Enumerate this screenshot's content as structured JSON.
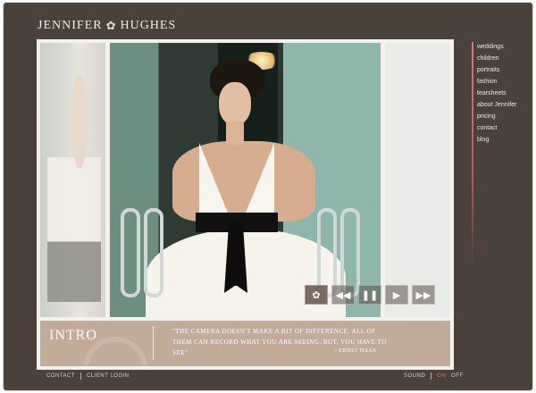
{
  "header": {
    "logo_left": "JENNIFER",
    "logo_right": "HUGHES",
    "logo_icon": "flower-icon"
  },
  "controls": {
    "buttons": [
      {
        "name": "flower-icon",
        "glyph": "✿"
      },
      {
        "name": "rewind-icon",
        "glyph": "◀◀"
      },
      {
        "name": "pause-icon",
        "glyph": "❚❚"
      },
      {
        "name": "play-icon",
        "glyph": "▶"
      },
      {
        "name": "fast-forward-icon",
        "glyph": "▶▶"
      }
    ]
  },
  "intro": {
    "title": "INTRO",
    "quote": "\"The camera doesn't make a bit of difference. All of them can record what you are seeing. But, you have to see\"",
    "author": "- Ernst Haas"
  },
  "nav": {
    "items": [
      "weddings",
      "children",
      "portraits",
      "fashion",
      "tearsheets",
      "about Jennifer",
      "pricing",
      "contact",
      "blog"
    ]
  },
  "footer": {
    "left": [
      "CONTACT",
      "CLIENT LOGIN"
    ],
    "sound_label": "SOUND",
    "on": "ON",
    "off": "OFF"
  },
  "colors": {
    "frame": "#4a413a",
    "accent": "#d7767a",
    "intro_bg": "#c2ab99"
  }
}
